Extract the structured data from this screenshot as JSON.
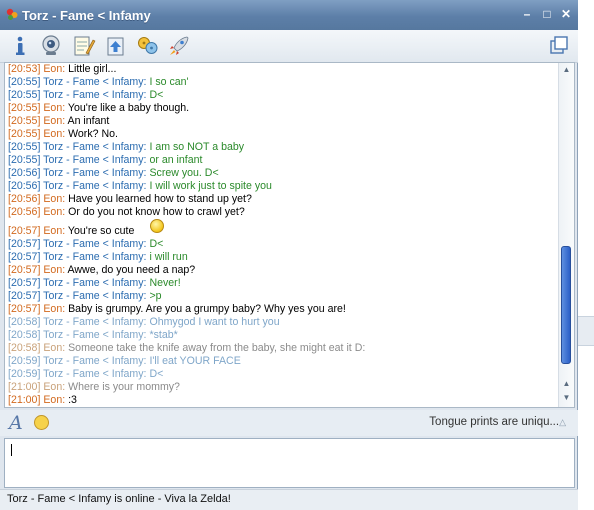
{
  "window": {
    "title": "Torz - Fame < Infamy"
  },
  "colors": {
    "titlebar": "#5d7fa8",
    "remote_timestamp": "#2b6cb0",
    "remote_name": "#2b6cb0",
    "remote_text": "#2b8a2b",
    "local_timestamp": "#d2691e",
    "local_name": "#d2691e",
    "local_text": "#000000",
    "faded_remote": "#7fa6c9",
    "faded_local": "#c9a27a",
    "faded_text": "#8b8b8b",
    "scroll_thumb": "#2b5fc7"
  },
  "toolbar": {
    "icons": [
      "info-icon",
      "webcam-icon",
      "notepad-icon",
      "send-file-icon",
      "games-icon",
      "rocket-icon"
    ],
    "expand_icon": "expand-icon"
  },
  "messages": [
    {
      "ts": "[20:53]",
      "who": "local",
      "name": "Eon:",
      "text": "Little girl...",
      "faded": false
    },
    {
      "ts": "[20:55]",
      "who": "remote",
      "name": "Torz - Fame < Infamy:",
      "text": "I so can'",
      "faded": false
    },
    {
      "ts": "[20:55]",
      "who": "remote",
      "name": "Torz - Fame < Infamy:",
      "text": "D<",
      "faded": false
    },
    {
      "ts": "[20:55]",
      "who": "local",
      "name": "Eon:",
      "text": "You're like a baby though.",
      "faded": false
    },
    {
      "ts": "[20:55]",
      "who": "local",
      "name": "Eon:",
      "text": "An infant",
      "faded": false
    },
    {
      "ts": "[20:55]",
      "who": "local",
      "name": "Eon:",
      "text": "Work? No.",
      "faded": false
    },
    {
      "ts": "[20:55]",
      "who": "remote",
      "name": "Torz - Fame < Infamy:",
      "text": "I am so NOT a baby",
      "faded": false
    },
    {
      "ts": "[20:55]",
      "who": "remote",
      "name": "Torz - Fame < Infamy:",
      "text": "or an infant",
      "faded": false
    },
    {
      "ts": "[20:56]",
      "who": "remote",
      "name": "Torz - Fame < Infamy:",
      "text": "Screw you. D<",
      "faded": false
    },
    {
      "ts": "[20:56]",
      "who": "remote",
      "name": "Torz - Fame < Infamy:",
      "text": "I will work just to spite you",
      "faded": false
    },
    {
      "ts": "[20:56]",
      "who": "local",
      "name": "Eon:",
      "text": "Have you learned how to stand up yet?",
      "faded": false
    },
    {
      "ts": "[20:56]",
      "who": "local",
      "name": "Eon:",
      "text": "Or do you not know how to crawl yet?",
      "faded": false
    },
    {
      "ts": "[20:57]",
      "who": "local",
      "name": "Eon:",
      "text": "You're so cute",
      "faded": false
    },
    {
      "ts": "[20:57]",
      "who": "remote",
      "name": "Torz - Fame < Infamy:",
      "text": "D<",
      "faded": false
    },
    {
      "ts": "[20:57]",
      "who": "remote",
      "name": "Torz - Fame < Infamy:",
      "text": "i will run",
      "faded": false
    },
    {
      "ts": "[20:57]",
      "who": "local",
      "name": "Eon:",
      "text": "Awwe, do you need a nap?",
      "faded": false
    },
    {
      "ts": "[20:57]",
      "who": "remote",
      "name": "Torz - Fame < Infamy:",
      "text": "Never!",
      "faded": false
    },
    {
      "ts": "[20:57]",
      "who": "remote",
      "name": "Torz - Fame < Infamy:",
      "text": ">p",
      "faded": false
    },
    {
      "ts": "[20:57]",
      "who": "local",
      "name": "Eon:",
      "text": "Baby is grumpy. Are you a grumpy baby? Why yes you are!",
      "faded": false
    },
    {
      "ts": "[20:58]",
      "who": "remote",
      "name": "Torz - Fame < Infamy:",
      "text": "Ohmygod I want to hurt you",
      "faded": true
    },
    {
      "ts": "[20:58]",
      "who": "remote",
      "name": "Torz - Fame < Infamy:",
      "text": "*stab*",
      "faded": true
    },
    {
      "ts": "[20:58]",
      "who": "local",
      "name": "Eon:",
      "text": "Someone take the knife away from the baby, she might eat it D:",
      "faded": true
    },
    {
      "ts": "[20:59]",
      "who": "remote",
      "name": "Torz - Fame < Infamy:",
      "text": "I'll eat YOUR FACE",
      "faded": true
    },
    {
      "ts": "[20:59]",
      "who": "remote",
      "name": "Torz - Fame < Infamy:",
      "text": "D<",
      "faded": true
    },
    {
      "ts": "[21:00]",
      "who": "local",
      "name": "Eon:",
      "text": "Where is your mommy?",
      "faded": true
    },
    {
      "ts": "[21:00]",
      "who": "local",
      "name": "Eon:",
      "text": ":3",
      "faded": false
    }
  ],
  "format_bar": {
    "tagline": "Tongue prints are uniqu..."
  },
  "input": {
    "value": ""
  },
  "status": {
    "text": "Torz - Fame < Infamy is online - Viva la Zelda!"
  }
}
